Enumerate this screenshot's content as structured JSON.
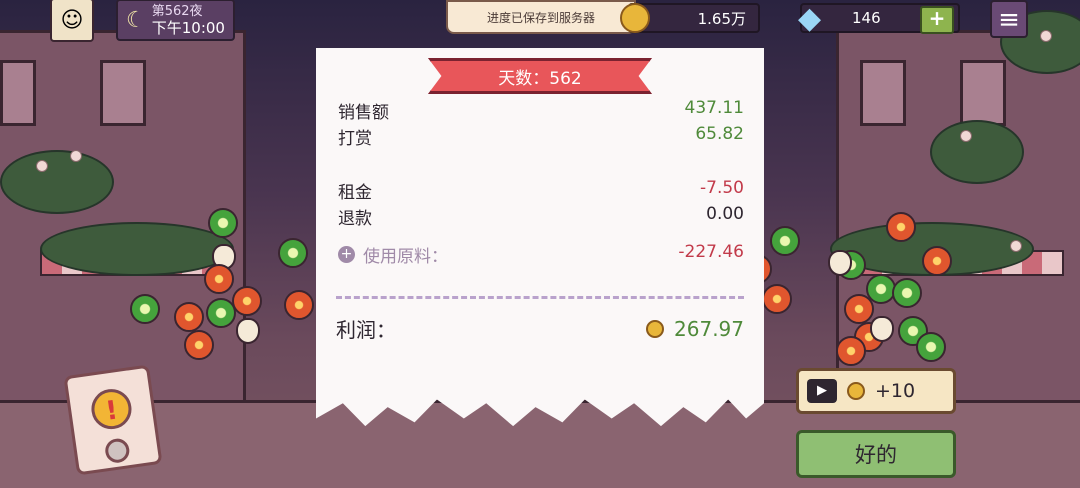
{
  "hud": {
    "day_label": "第562夜",
    "time": "下午10:00",
    "avatar_icon": "girl-avatar-icon",
    "moon_icon": "moon-icon",
    "toast": "进度已保存到服务器",
    "coins": "1.65万",
    "gems": "146",
    "add_gems": "+",
    "menu_icon": "hamburger-menu-icon"
  },
  "receipt": {
    "banner": "天数：562",
    "rows": [
      {
        "label": "销售额",
        "value": "437.11"
      },
      {
        "label": "打赏",
        "value": "65.82"
      },
      {
        "label": "租金",
        "value": "-7.50"
      },
      {
        "label": "退款",
        "value": "0.00"
      }
    ],
    "ingredients_label": "使用原料：",
    "ingredients_value": "-227.46",
    "profit_label": "利润：",
    "profit_value": "267.97"
  },
  "buttons": {
    "ad_reward": "+10",
    "ok": "好的"
  },
  "colors": {
    "positive": "#4f8a3a",
    "negative": "#c23a4a",
    "banner": "#e8565a",
    "ok_button": "#8fbf73"
  }
}
